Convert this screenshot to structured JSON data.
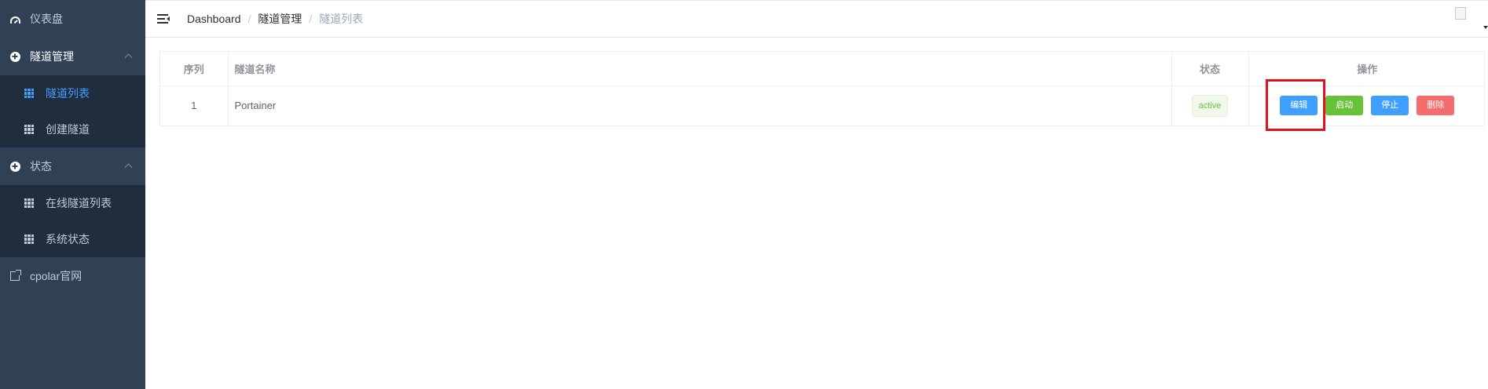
{
  "sidebar": {
    "items": [
      {
        "label": "仪表盘",
        "icon": "dashboard-icon"
      },
      {
        "label": "隧道管理",
        "icon": "plus-circle-icon",
        "expanded": true,
        "children": [
          {
            "label": "隧道列表",
            "icon": "grid-icon",
            "active": true
          },
          {
            "label": "创建隧道",
            "icon": "grid-icon"
          }
        ]
      },
      {
        "label": "状态",
        "icon": "plus-circle-icon",
        "expanded": true,
        "children": [
          {
            "label": "在线隧道列表",
            "icon": "grid-icon"
          },
          {
            "label": "系统状态",
            "icon": "grid-icon"
          }
        ]
      },
      {
        "label": "cpolar官网",
        "icon": "external-link-icon"
      }
    ]
  },
  "header": {
    "breadcrumb": [
      "Dashboard",
      "隧道管理",
      "隧道列表"
    ],
    "separator": "/"
  },
  "table": {
    "headers": [
      "序列",
      "隧道名称",
      "状态",
      "操作"
    ],
    "rows": [
      {
        "index": "1",
        "name": "Portainer",
        "status": "active",
        "actions": [
          "编辑",
          "启动",
          "停止",
          "删除"
        ]
      }
    ]
  },
  "colors": {
    "sidebar_bg": "#304156",
    "submenu_bg": "#1f2d3d",
    "primary": "#409eff",
    "success": "#67c23a",
    "danger": "#f56c6c",
    "highlight": "#e0141e"
  }
}
